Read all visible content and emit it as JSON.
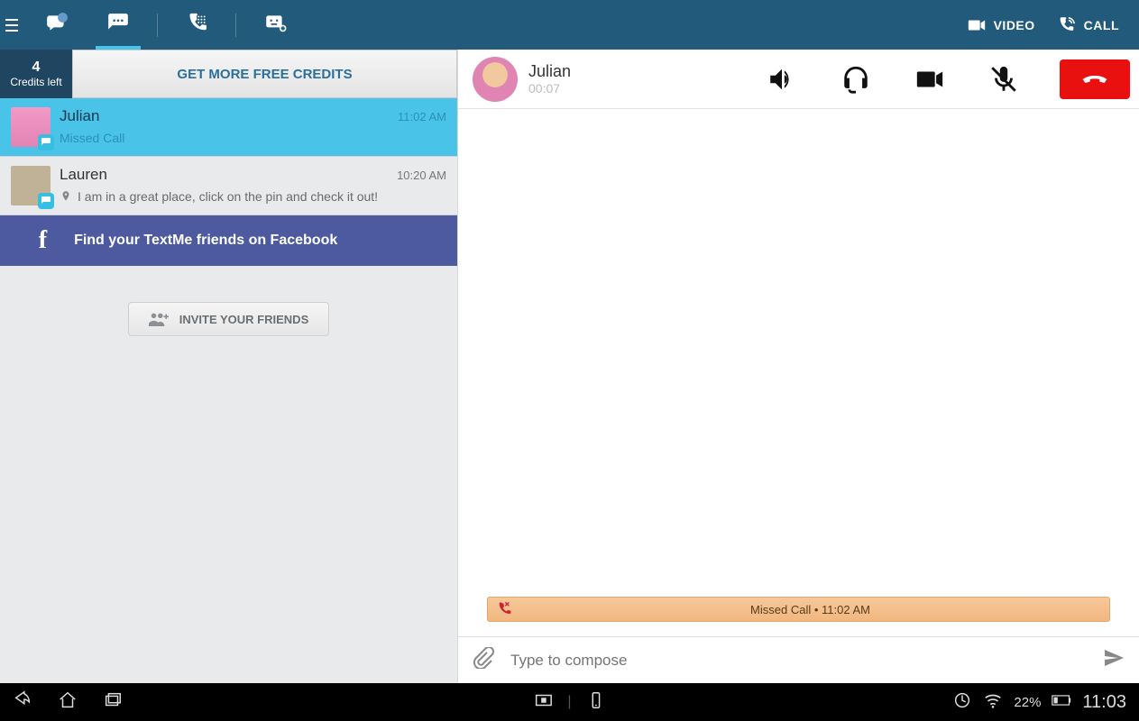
{
  "topbar": {
    "video_label": "VIDEO",
    "call_label": "CALL"
  },
  "credits": {
    "count": "4",
    "label": "Credits left",
    "button": "GET MORE FREE CREDITS"
  },
  "conversations": [
    {
      "name": "Julian",
      "time": "11:02 AM",
      "preview": "Missed Call",
      "selected": true
    },
    {
      "name": "Lauren",
      "time": "10:20 AM",
      "preview": "I am in a great place, click on the pin and check it out!",
      "selected": false
    }
  ],
  "facebook": {
    "cta": "Find your TextMe friends on Facebook"
  },
  "invite": {
    "label": "INVITE YOUR FRIENDS"
  },
  "chat": {
    "contact_name": "Julian",
    "call_timer": "00:07",
    "missed_text": "Missed Call • 11:02 AM"
  },
  "compose": {
    "placeholder": "Type to compose"
  },
  "statusbar": {
    "battery": "22%",
    "time": "11:03"
  }
}
